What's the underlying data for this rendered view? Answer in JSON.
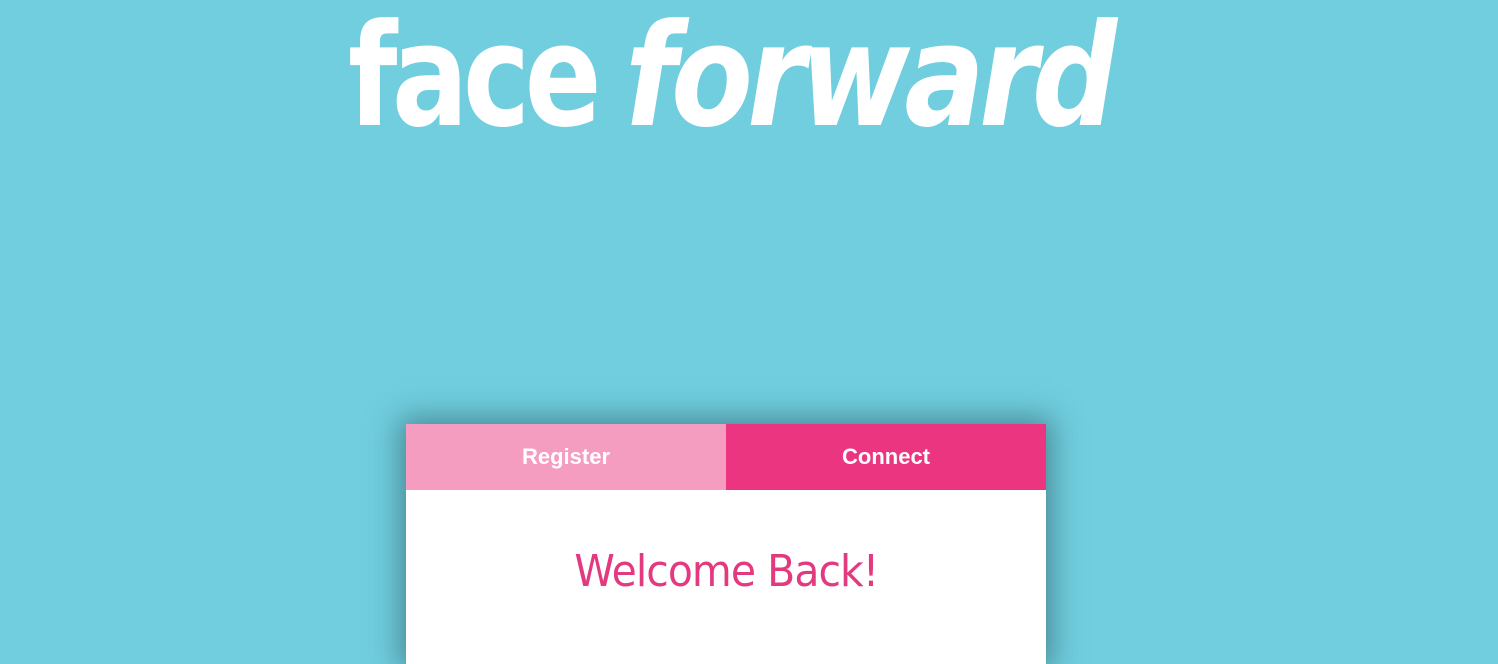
{
  "logo": {
    "part1": "face",
    "part2": "forward"
  },
  "tabs": {
    "register_label": "Register",
    "connect_label": "Connect"
  },
  "card": {
    "heading": "Welcome Back!"
  },
  "colors": {
    "background": "#70cede",
    "register_tab": "#f59dc0",
    "connect_tab": "#ec3580",
    "heading": "#e33a7f",
    "logo_text": "#ffffff"
  }
}
